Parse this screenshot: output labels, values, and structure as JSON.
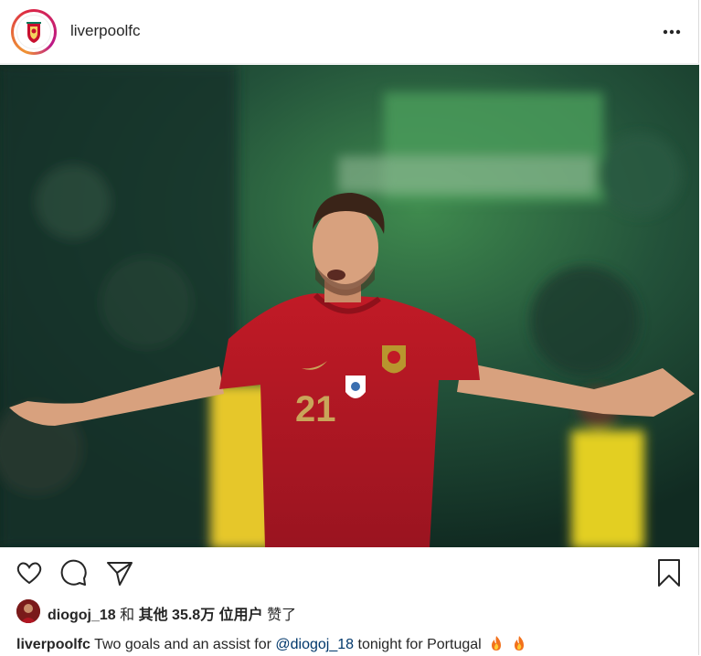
{
  "header": {
    "username": "liverpoolfc",
    "avatar_icon": "liverpool-crest-icon",
    "more_icon": "more-options-icon"
  },
  "photo": {
    "player_number": "21",
    "description_icon": "football-player-celebrating-photo"
  },
  "actions": {
    "like_icon": "heart-icon",
    "comment_icon": "comment-icon",
    "share_icon": "paper-plane-icon",
    "save_icon": "bookmark-icon"
  },
  "likes": {
    "first_user": "diogoj_18",
    "and_text": "和",
    "others_text": "其他 35.8万 位用户",
    "liked_text": "赞了"
  },
  "caption": {
    "username": "liverpoolfc",
    "text_before": "Two goals and an assist for",
    "mention": "@diogoj_18",
    "text_after": "tonight for Portugal",
    "emoji": "fire-icon"
  },
  "colors": {
    "text": "#262626",
    "mention": "#00376b",
    "border": "#dbdbdb",
    "jersey_red": "#c8102e"
  }
}
